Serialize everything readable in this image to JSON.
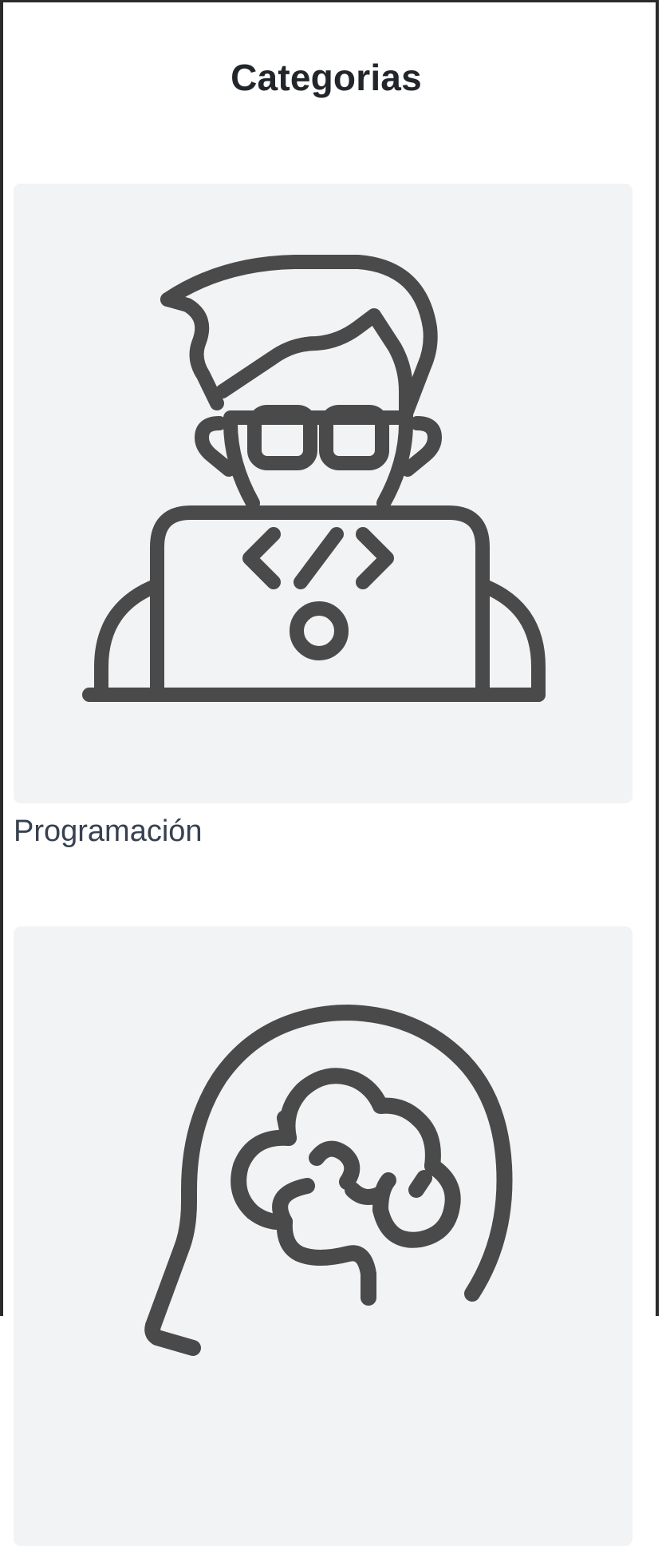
{
  "page": {
    "title": "Categorias"
  },
  "categories": [
    {
      "label": "Programación",
      "icon": "developer-laptop-icon"
    },
    {
      "label": "",
      "icon": "brain-head-icon"
    }
  ],
  "colors": {
    "icon_stroke": "#4a4a4a",
    "card_background": "#f2f3f5",
    "label_text": "#374151",
    "title_text": "#22262b"
  }
}
